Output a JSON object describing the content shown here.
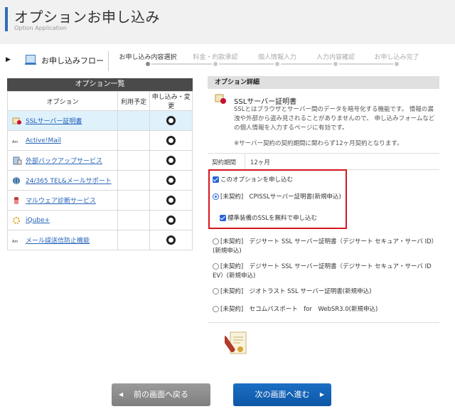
{
  "header": {
    "title": "オプションお申し込み",
    "subtitle": "Option Application"
  },
  "flow": {
    "label": "お申し込みフロー",
    "steps": [
      "お申し込み内容選択",
      "料金・約款承認",
      "個人情報入力",
      "入力内容確認",
      "お申し込み完了"
    ],
    "active_step": 0
  },
  "options_table": {
    "title": "オプション一覧",
    "headers": [
      "オプション",
      "利用予定",
      "申し込み・変更"
    ],
    "rows": [
      {
        "name": "SSLサーバー証明書",
        "icon": "ssl-certificate-icon",
        "selected": true
      },
      {
        "name": "Active!Mail",
        "icon": "active-mail-icon",
        "selected": false
      },
      {
        "name": "外部バックアップサービス",
        "icon": "backup-server-icon",
        "selected": false
      },
      {
        "name": "24/365 TEL&メールサポート",
        "icon": "support-globe-icon",
        "selected": false
      },
      {
        "name": "マルウェア診断サービス",
        "icon": "malware-scan-icon",
        "selected": false
      },
      {
        "name": "iQube+",
        "icon": "iqube-icon",
        "selected": false
      },
      {
        "name": "メール誤送信防止機能",
        "icon": "mail-safety-icon",
        "selected": false
      }
    ]
  },
  "detail": {
    "title": "オプション詳細",
    "ssl_name": "SSLサーバー証明書",
    "ssl_desc": "SSLとはブラウザとサーバー間のデータを暗号化する機能です。 情報の漏洩や外部から盗み見されることがありませんので、 申し込みフォームなどの個人情報を入力するページに有効です。",
    "ssl_note": "※サーバー契約の契約期間に関わらず12ヶ月契約となります。",
    "period_label": "契約期間",
    "period_value": "12ヶ月",
    "apply_checkbox": "このオプションを申し込む",
    "cpi_option": "[未契約]　CPISSLサーバー証明書(新規申込)",
    "standard_checkbox": "標準装備のSSLを無料で申し込む",
    "option_digicert_id": "[未契約]　デジサート SSL サーバー証明書（デジサート セキュア・サーバ ID）(新規申込)",
    "option_digicert_ev": "[未契約]　デジサート SSL サーバー証明書（デジサート セキュア・サーバ ID EV）(新規申込)",
    "option_geotrust": "[未契約]　ジオトラスト SSL サーバー証明書(新規申込)",
    "option_secom": "[未契約]　セコムパスポート　for　WebSR3.0(新規申込)"
  },
  "buttons": {
    "back": "前の画面へ戻る",
    "next": "次の画面へ進む",
    "back_icon": "chevron-left-icon",
    "next_icon": "chevron-right-icon"
  },
  "colors": {
    "accent": "#2f6db5",
    "highlight_border": "#d9141d",
    "next_button": "#1b6fc4",
    "back_button": "#8c8c8c",
    "selected_row": "#dff1fb"
  }
}
